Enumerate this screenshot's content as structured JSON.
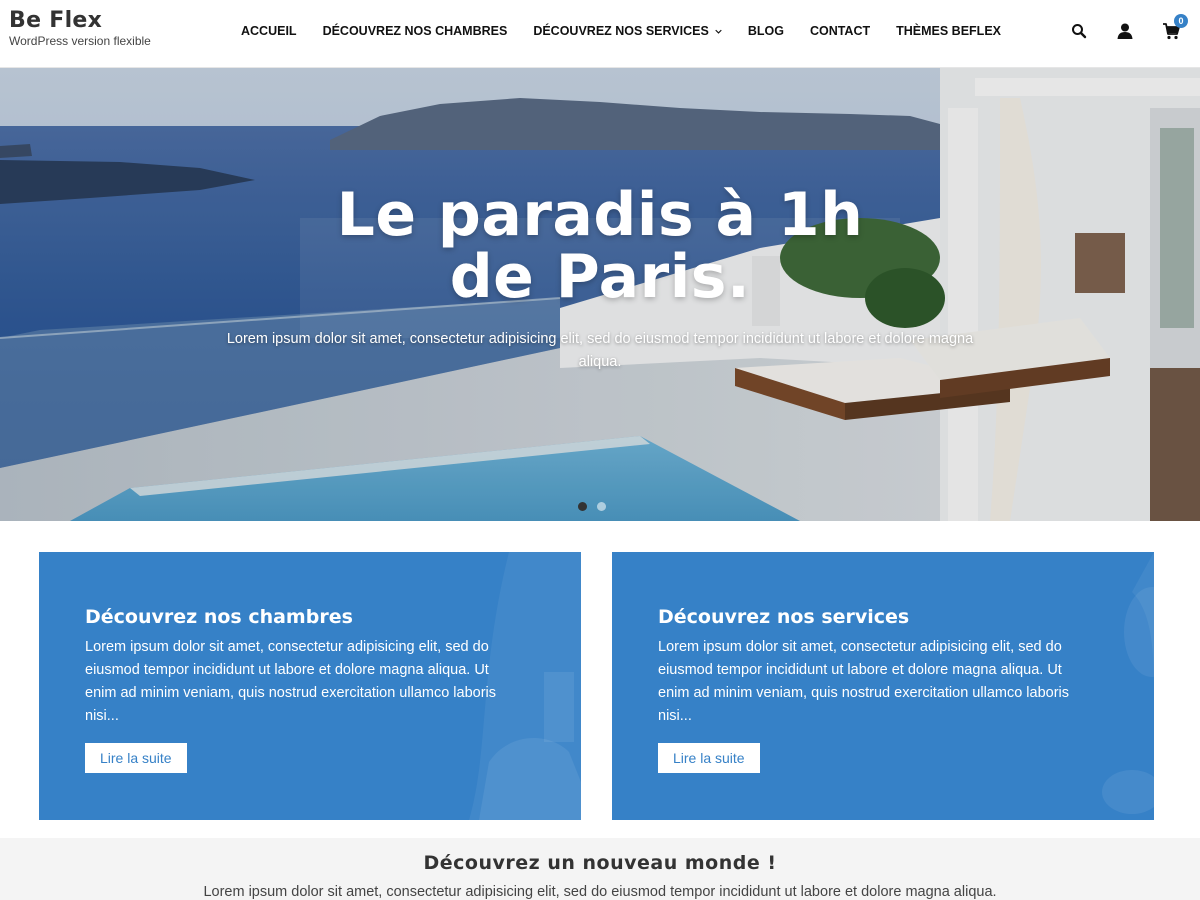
{
  "brand": {
    "title": "Be Flex",
    "tagline": "WordPress version flexible"
  },
  "nav": {
    "items": [
      {
        "label": "ACCUEIL"
      },
      {
        "label": "DÉCOUVREZ NOS CHAMBRES"
      },
      {
        "label": "DÉCOUVREZ NOS SERVICES"
      },
      {
        "label": "BLOG"
      },
      {
        "label": "CONTACT"
      },
      {
        "label": "THÈMES BEFLEX"
      }
    ]
  },
  "tools": {
    "cart_count": "0"
  },
  "hero": {
    "title": "Le paradis à 1h de Paris.",
    "subtitle": "Lorem ipsum dolor sit amet, consectetur adipisicing elit, sed do eiusmod tempor incididunt ut labore et dolore magna aliqua.",
    "slide_count": 2,
    "active_slide": 1
  },
  "cards": [
    {
      "title": "Découvrez nos chambres",
      "text": "Lorem ipsum dolor sit amet, consectetur adipisicing elit, sed do eiusmod tempor incididunt ut labore et dolore magna aliqua. Ut enim ad minim veniam, quis nostrud exercitation ullamco laboris nisi...",
      "button": "Lire la suite"
    },
    {
      "title": "Découvrez nos services",
      "text": "Lorem ipsum dolor sit amet, consectetur adipisicing elit, sed do eiusmod tempor incididunt ut labore et dolore magna aliqua. Ut enim ad minim veniam, quis nostrud exercitation ullamco laboris nisi...",
      "button": "Lire la suite"
    }
  ],
  "section": {
    "title": "Découvrez un nouveau monde !",
    "text": "Lorem ipsum dolor sit amet, consectetur adipisicing elit, sed do eiusmod tempor incididunt ut labore et dolore magna aliqua."
  },
  "colors": {
    "accent": "#3681c7",
    "header_text": "#111111",
    "section_bg": "#f4f4f4"
  }
}
